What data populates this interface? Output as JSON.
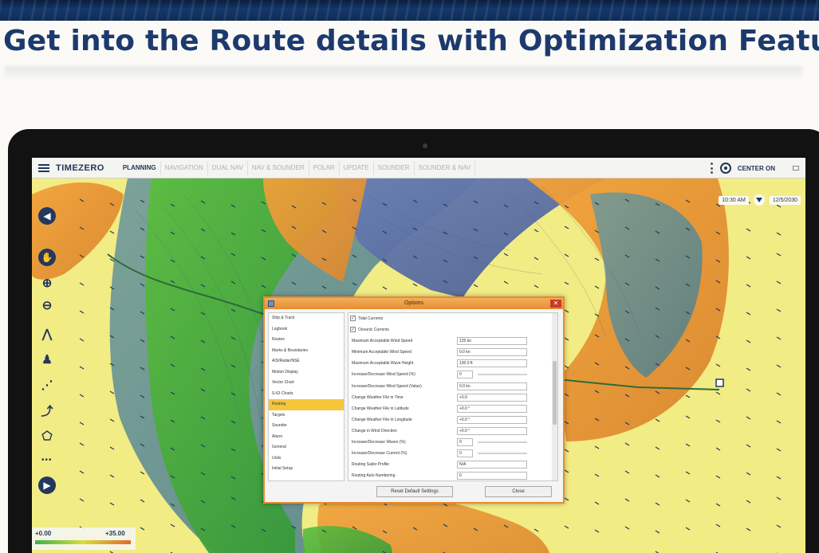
{
  "headline": "Get into the Route details with Optimization Feature",
  "app": {
    "brand": "TIMEZERO",
    "tabs": [
      {
        "label": "PLANNING",
        "active": true
      },
      {
        "label": "NAVIGATION",
        "active": false
      },
      {
        "label": "DUAL NAV",
        "active": false
      },
      {
        "label": "NAV & SOUNDER",
        "active": false
      },
      {
        "label": "POLAR",
        "active": false
      },
      {
        "label": "UPDATE",
        "active": false
      },
      {
        "label": "SOUNDER",
        "active": false
      },
      {
        "label": "SOUNDER & NAV",
        "active": false
      }
    ],
    "center_on_label": "CENTER ON",
    "time": {
      "clock": "10:30 AM",
      "date": "12/5/2030"
    },
    "icons": {
      "menu": "hamburger-menu-icon",
      "kebab": "kebab-menu-icon",
      "center": "target-center-icon",
      "back": "arrow-back-icon",
      "forward": "arrow-forward-icon",
      "pan": "hand-pan-icon",
      "zoom_in": "zoom-in-icon",
      "zoom_out": "zoom-out-icon",
      "compass": "compass-icon",
      "marker": "route-marker-icon",
      "route": "route-tool-icon",
      "measure": "measure-icon",
      "polygon": "polygon-icon"
    },
    "legend": {
      "min": "+0.00",
      "max": "+35.00"
    },
    "colors": {
      "brand_navy": "#24375f",
      "chart_yellow": "#f2ec85",
      "dialog_accent": "#e78c2c",
      "selected": "#f6c63a"
    }
  },
  "options_dialog": {
    "title": "Options",
    "categories": [
      {
        "label": "Ship & Track",
        "selected": false
      },
      {
        "label": "Logbook",
        "selected": false
      },
      {
        "label": "Routes",
        "selected": false
      },
      {
        "label": "Marks & Boundaries",
        "selected": false
      },
      {
        "label": "AIS/Radar/NSE",
        "selected": false
      },
      {
        "label": "Motion Display",
        "selected": false
      },
      {
        "label": "Vector Chart",
        "selected": false
      },
      {
        "label": "S-63 Charts",
        "selected": false
      },
      {
        "label": "Routing",
        "selected": true
      },
      {
        "label": "Targets",
        "selected": false
      },
      {
        "label": "Sounder",
        "selected": false
      },
      {
        "label": "Alarm",
        "selected": false
      },
      {
        "label": "General",
        "selected": false
      },
      {
        "label": "Units",
        "selected": false
      },
      {
        "label": "Initial Setup",
        "selected": false
      }
    ],
    "checkboxes": [
      {
        "label": "Tidal Currents",
        "checked": true
      },
      {
        "label": "Oceanic Currents",
        "checked": true
      }
    ],
    "settings": [
      {
        "label": "Maximum Acceptable Wind Speed",
        "value": "125 kn",
        "kind": "text"
      },
      {
        "label": "Minimum Acceptable Wind Speed",
        "value": "0.0 kn",
        "kind": "text"
      },
      {
        "label": "Maximum Acceptable Wave Height",
        "value": "100.0 ft",
        "kind": "text"
      },
      {
        "label": "Increase/Decrease Wind Speed (%)",
        "value": "0",
        "kind": "slider"
      },
      {
        "label": "Increase/Decrease Wind Speed (Value)",
        "value": "0.0 kn",
        "kind": "text"
      },
      {
        "label": "Change Weather File in Time",
        "value": "+0.0",
        "kind": "text"
      },
      {
        "label": "Change Weather File in Latitude",
        "value": "+0.0 °",
        "kind": "text"
      },
      {
        "label": "Change Weather File in Longitude",
        "value": "+0.0 °",
        "kind": "text"
      },
      {
        "label": "Change in Wind Direction",
        "value": "+0.0 °",
        "kind": "text"
      },
      {
        "label": "Increase/Decrease Waves (%)",
        "value": "0",
        "kind": "slider"
      },
      {
        "label": "Increase/Decrease Current (%)",
        "value": "0",
        "kind": "slider"
      },
      {
        "label": "Routing Sailor Profile",
        "value": "N/A",
        "kind": "text"
      },
      {
        "label": "Routing Auto Numbering",
        "value": "0",
        "kind": "text"
      }
    ],
    "reset_label": "Reset Default Settings",
    "close_label": "Close"
  }
}
